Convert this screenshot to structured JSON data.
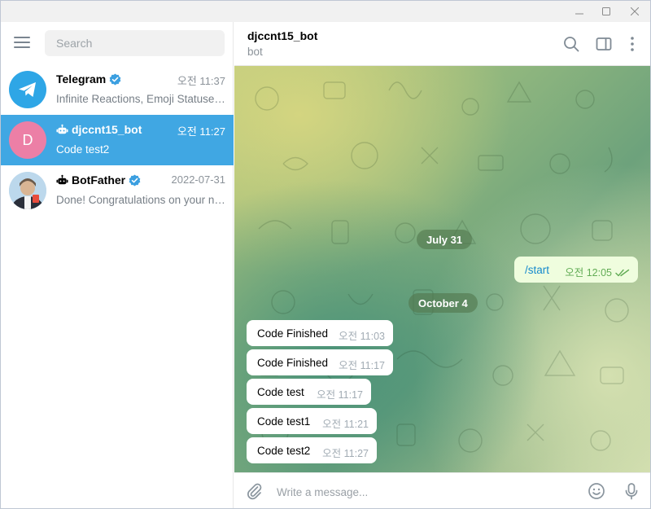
{
  "window": {
    "minimize_icon": "minimize-icon",
    "maximize_icon": "maximize-icon",
    "close_icon": "close-icon"
  },
  "sidebar": {
    "search_placeholder": "Search",
    "chats": [
      {
        "name": "Telegram",
        "verified": true,
        "is_bot": false,
        "time": "오전 11:37",
        "preview": "Infinite Reactions, Emoji Statuses, Re...",
        "avatar_color": "#2ea6e6",
        "active": false
      },
      {
        "name": "djccnt15_bot",
        "verified": false,
        "is_bot": true,
        "time": "오전 11:27",
        "preview": "Code test2",
        "avatar_letter": "D",
        "avatar_color": "#ec7fa6",
        "active": true
      },
      {
        "name": "BotFather",
        "verified": true,
        "is_bot": true,
        "time": "2022-07-31",
        "preview": "Done! Congratulations on your new bot...",
        "active": false
      }
    ]
  },
  "chat": {
    "peer_name": "djccnt15_bot",
    "peer_status": "bot",
    "date_1": "July 31",
    "date_2": "October 4",
    "outgoing": [
      {
        "text": "/start",
        "time": "오전 12:05",
        "read": true
      }
    ],
    "incoming": [
      {
        "text": "Code Finished",
        "time": "오전 11:03"
      },
      {
        "text": "Code Finished",
        "time": "오전 11:17"
      },
      {
        "text": "Code test",
        "time": "오전 11:17"
      },
      {
        "text": "Code test1",
        "time": "오전 11:21"
      },
      {
        "text": "Code test2",
        "time": "오전 11:27"
      }
    ],
    "composer_placeholder": "Write a message..."
  },
  "colors": {
    "accent": "#40a7e3",
    "outgoing_bubble": "#effdde",
    "read_check": "#62ac55"
  }
}
